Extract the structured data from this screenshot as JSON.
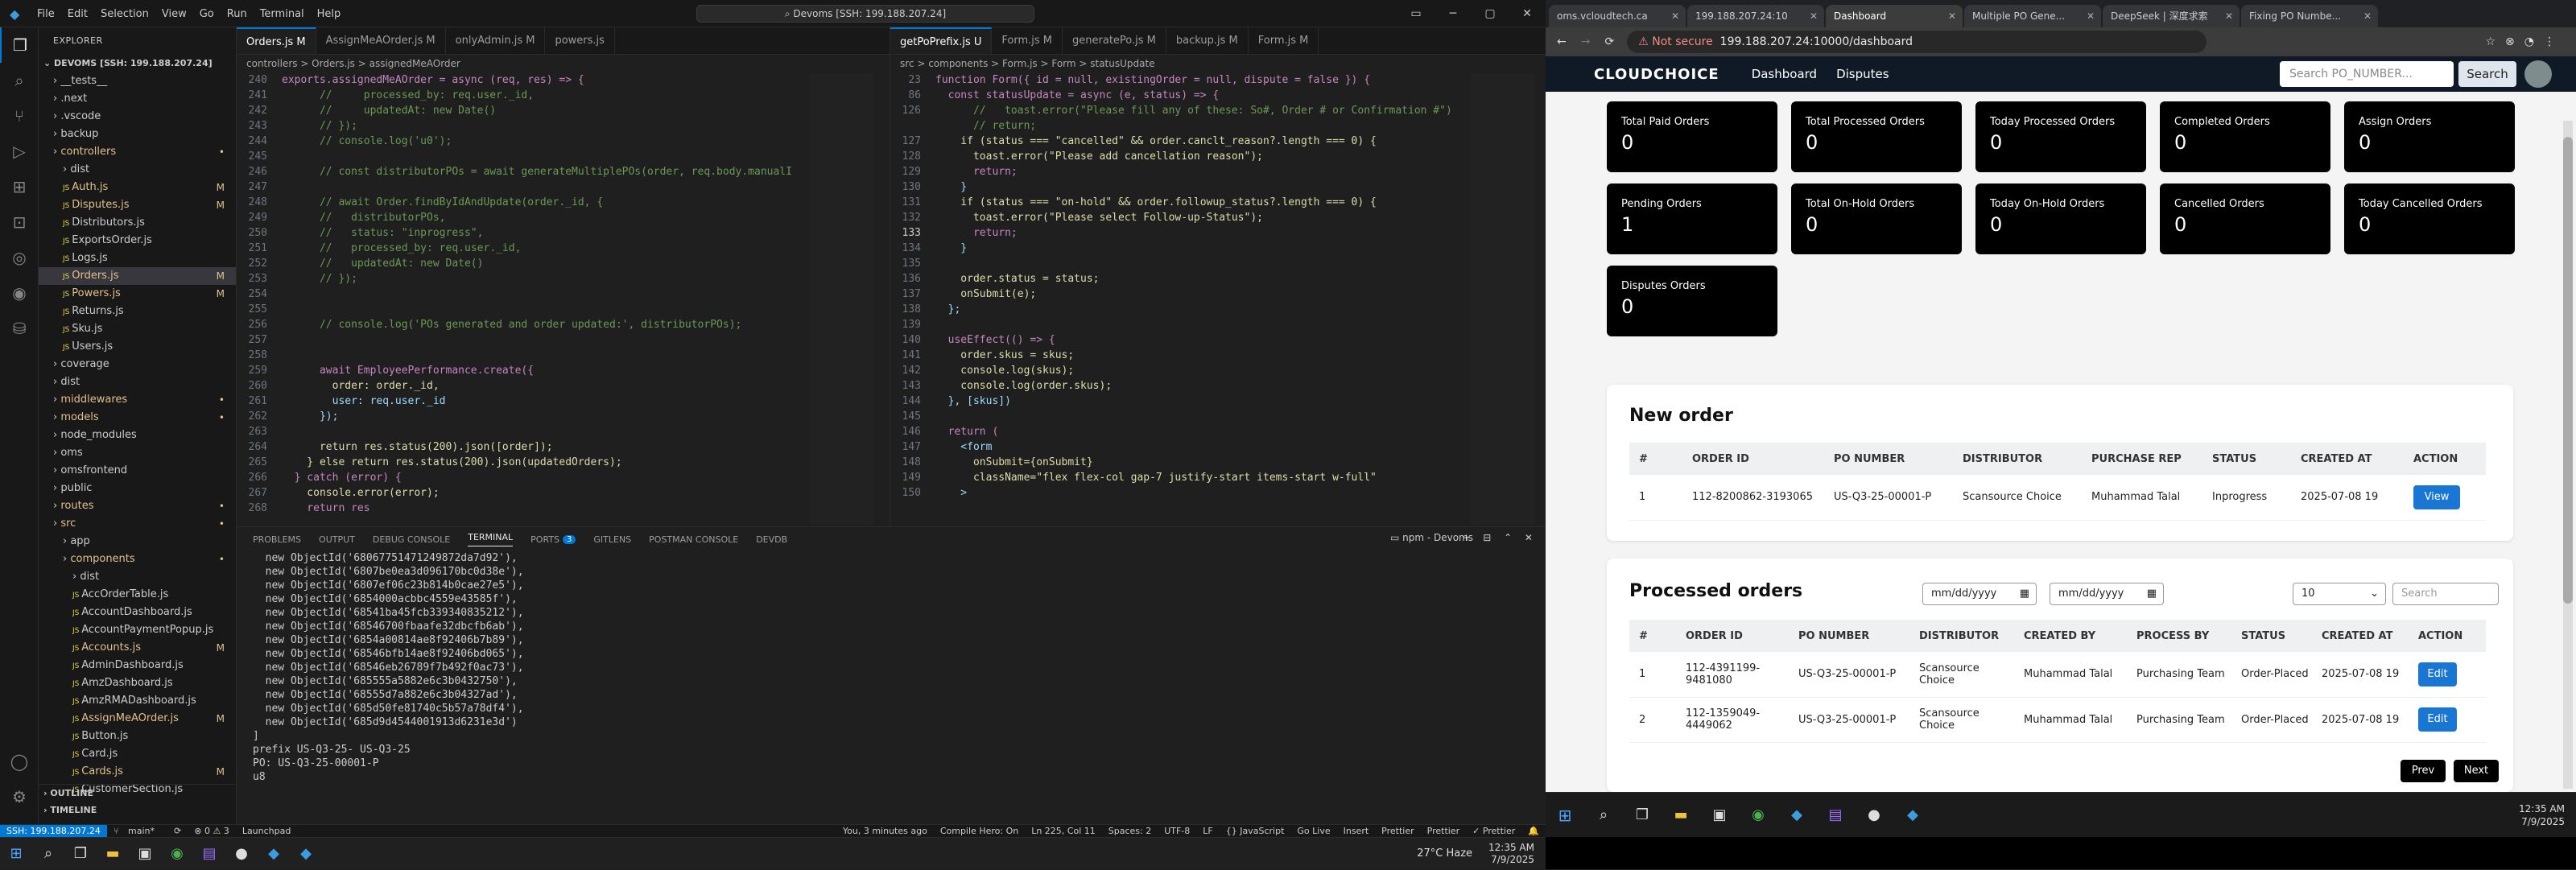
{
  "vscode": {
    "menu": [
      "File",
      "Edit",
      "Selection",
      "View",
      "Go",
      "Run",
      "Terminal",
      "Help"
    ],
    "command_center": "Devoms [SSH: 199.188.207.24]",
    "explorer_title": "EXPLORER",
    "workspace": "DEVOMS [SSH: 199.188.207.24]",
    "tree": [
      {
        "label": "__tests__",
        "indent": 1,
        "status": ""
      },
      {
        "label": ".next",
        "indent": 1,
        "status": ""
      },
      {
        "label": ".vscode",
        "indent": 1,
        "status": ""
      },
      {
        "label": "backup",
        "indent": 1,
        "status": ""
      },
      {
        "label": "controllers",
        "indent": 1,
        "status": "•"
      },
      {
        "label": "dist",
        "indent": 2,
        "status": ""
      },
      {
        "label": "Auth.js",
        "indent": 2,
        "status": "M"
      },
      {
        "label": "Disputes.js",
        "indent": 2,
        "status": "M"
      },
      {
        "label": "Distributors.js",
        "indent": 2,
        "status": ""
      },
      {
        "label": "ExportsOrder.js",
        "indent": 2,
        "status": ""
      },
      {
        "label": "Logs.js",
        "indent": 2,
        "status": ""
      },
      {
        "label": "Orders.js",
        "indent": 2,
        "status": "M",
        "selected": true
      },
      {
        "label": "Powers.js",
        "indent": 2,
        "status": "M"
      },
      {
        "label": "Returns.js",
        "indent": 2,
        "status": ""
      },
      {
        "label": "Sku.js",
        "indent": 2,
        "status": ""
      },
      {
        "label": "Users.js",
        "indent": 2,
        "status": ""
      },
      {
        "label": "coverage",
        "indent": 1,
        "status": ""
      },
      {
        "label": "dist",
        "indent": 1,
        "status": ""
      },
      {
        "label": "middlewares",
        "indent": 1,
        "status": "•"
      },
      {
        "label": "models",
        "indent": 1,
        "status": "•"
      },
      {
        "label": "node_modules",
        "indent": 1,
        "status": ""
      },
      {
        "label": "oms",
        "indent": 1,
        "status": ""
      },
      {
        "label": "omsfrontend",
        "indent": 1,
        "status": ""
      },
      {
        "label": "public",
        "indent": 1,
        "status": ""
      },
      {
        "label": "routes",
        "indent": 1,
        "status": "•"
      },
      {
        "label": "src",
        "indent": 1,
        "status": "•"
      },
      {
        "label": "app",
        "indent": 2,
        "status": ""
      },
      {
        "label": "components",
        "indent": 2,
        "status": "•"
      },
      {
        "label": "dist",
        "indent": 3,
        "status": ""
      },
      {
        "label": "AccOrderTable.js",
        "indent": 3,
        "status": ""
      },
      {
        "label": "AccountDashboard.js",
        "indent": 3,
        "status": ""
      },
      {
        "label": "AccountPaymentPopup.js",
        "indent": 3,
        "status": ""
      },
      {
        "label": "Accounts.js",
        "indent": 3,
        "status": "M"
      },
      {
        "label": "AdminDashboard.js",
        "indent": 3,
        "status": ""
      },
      {
        "label": "AmzDashboard.js",
        "indent": 3,
        "status": ""
      },
      {
        "label": "AmzRMADashboard.js",
        "indent": 3,
        "status": ""
      },
      {
        "label": "AssignMeAOrder.js",
        "indent": 3,
        "status": "M"
      },
      {
        "label": "Button.js",
        "indent": 3,
        "status": ""
      },
      {
        "label": "Card.js",
        "indent": 3,
        "status": ""
      },
      {
        "label": "Cards.js",
        "indent": 3,
        "status": "M"
      },
      {
        "label": "CustomerSection.js",
        "indent": 3,
        "status": ""
      }
    ],
    "outline": "OUTLINE",
    "timeline": "TIMELINE",
    "left_tabs": [
      "Orders.js M",
      "AssignMeAOrder.js M",
      "onlyAdmin.js M",
      "powers.js"
    ],
    "left_breadcrumb": "controllers > Orders.js > assignedMeAOrder",
    "left_code": [
      {
        "n": "240",
        "t": "exports.assignedMeAOrder = async (req, res) => {"
      },
      {
        "n": "241",
        "t": "      //     processed_by: req.user._id,"
      },
      {
        "n": "242",
        "t": "      //     updatedAt: new Date()"
      },
      {
        "n": "243",
        "t": "      // });"
      },
      {
        "n": "244",
        "t": "      // console.log('u0');"
      },
      {
        "n": "245",
        "t": ""
      },
      {
        "n": "246",
        "t": "      // const distributorPOs = await generateMultiplePOs(order, req.body.manualI"
      },
      {
        "n": "247",
        "t": ""
      },
      {
        "n": "248",
        "t": "      // await Order.findByIdAndUpdate(order._id, {"
      },
      {
        "n": "249",
        "t": "      //   distributorPOs,"
      },
      {
        "n": "250",
        "t": "      //   status: \"inprogress\","
      },
      {
        "n": "251",
        "t": "      //   processed_by: req.user._id,"
      },
      {
        "n": "252",
        "t": "      //   updatedAt: new Date()"
      },
      {
        "n": "253",
        "t": "      // });"
      },
      {
        "n": "254",
        "t": ""
      },
      {
        "n": "255",
        "t": ""
      },
      {
        "n": "256",
        "t": "      // console.log('POs generated and order updated:', distributorPOs);"
      },
      {
        "n": "257",
        "t": ""
      },
      {
        "n": "258",
        "t": ""
      },
      {
        "n": "259",
        "t": "      await EmployeePerformance.create({"
      },
      {
        "n": "260",
        "t": "        order: order._id,"
      },
      {
        "n": "261",
        "t": "        user: req.user._id"
      },
      {
        "n": "262",
        "t": "      });"
      },
      {
        "n": "263",
        "t": ""
      },
      {
        "n": "264",
        "t": "      return res.status(200).json([order]);"
      },
      {
        "n": "265",
        "t": "    } else return res.status(200).json(updatedOrders);"
      },
      {
        "n": "266",
        "t": "  } catch (error) {"
      },
      {
        "n": "267",
        "t": "    console.error(error);"
      },
      {
        "n": "268",
        "t": "    return res"
      }
    ],
    "right_tabs": [
      "getPoPrefix.js U",
      "Form.js M",
      "generatePo.js M",
      "backup.js M",
      "Form.js M"
    ],
    "right_breadcrumb": "src > components > Form.js > Form > statusUpdate",
    "right_code": [
      {
        "n": "23",
        "t": "function Form({ id = null, existingOrder = null, dispute = false }) {"
      },
      {
        "n": "86",
        "t": "  const statusUpdate = async (e, status) => {"
      },
      {
        "n": "126",
        "t": "      //   toast.error(\"Please fill any of these: So#, Order # or Confirmation #\")"
      },
      {
        "n": "",
        "t": "      // return;"
      },
      {
        "n": "127",
        "t": "    if (status === \"cancelled\" && order.canclt_reason?.length === 0) {"
      },
      {
        "n": "128",
        "t": "      toast.error(\"Please add cancellation reason\");"
      },
      {
        "n": "129",
        "t": "      return;"
      },
      {
        "n": "130",
        "t": "    }"
      },
      {
        "n": "131",
        "t": "    if (status === \"on-hold\" && order.followup_status?.length === 0) {"
      },
      {
        "n": "132",
        "t": "      toast.error(\"Please select Follow-up-Status\");"
      },
      {
        "n": "133",
        "t": "      return;"
      },
      {
        "n": "134",
        "t": "    }"
      },
      {
        "n": "135",
        "t": ""
      },
      {
        "n": "136",
        "t": "    order.status = status;"
      },
      {
        "n": "137",
        "t": "    onSubmit(e);"
      },
      {
        "n": "138",
        "t": "  };"
      },
      {
        "n": "139",
        "t": ""
      },
      {
        "n": "140",
        "t": "  useEffect(() => {"
      },
      {
        "n": "141",
        "t": "    order.skus = skus;"
      },
      {
        "n": "142",
        "t": "    console.log(skus);"
      },
      {
        "n": "143",
        "t": "    console.log(order.skus);"
      },
      {
        "n": "144",
        "t": "  }, [skus])"
      },
      {
        "n": "145",
        "t": ""
      },
      {
        "n": "146",
        "t": "  return ("
      },
      {
        "n": "147",
        "t": "    <form"
      },
      {
        "n": "148",
        "t": "      onSubmit={onSubmit}"
      },
      {
        "n": "149",
        "t": "      className=\"flex flex-col gap-7 justify-start items-start w-full\""
      },
      {
        "n": "150",
        "t": "    >"
      }
    ],
    "panel_tabs": [
      "PROBLEMS",
      "OUTPUT",
      "DEBUG CONSOLE",
      "TERMINAL",
      "PORTS",
      "GITLENS",
      "POSTMAN CONSOLE",
      "DEVDB"
    ],
    "ports_badge": "3",
    "terminal_name": "npm - Devoms",
    "terminal_lines": [
      "  new ObjectId('68067751471249872da7d92'),",
      "  new ObjectId('6807be0ea3d096170bc0d38e'),",
      "  new ObjectId('6807ef06c23b814b0cae27e5'),",
      "  new ObjectId('6854000acbbc4559e43585f'),",
      "  new ObjectId('68541ba45fcb339340835212'),",
      "  new ObjectId('68546700fbaafe32dbcfb6ab'),",
      "  new ObjectId('6854a00814ae8f92406b7b89'),",
      "  new ObjectId('68546bfb14ae8f92406bd065'),",
      "  new ObjectId('68546eb26789f7b492f0ac73'),",
      "  new ObjectId('685555a5882e6c3b0432750'),",
      "  new ObjectId('68555d7a882e6c3b04327ad'),",
      "  new ObjectId('685d50fe81740c5b57a78df4'),",
      "  new ObjectId('685d9d4544001913d6231e3d')",
      "]",
      "prefix US-Q3-25- US-Q3-25",
      "PO: US-Q3-25-00001-P",
      "u8"
    ],
    "status": {
      "remote": "SSH: 199.188.207.24",
      "branch": "main*",
      "sync": "⟳",
      "errors": "⊗ 0 ⚠ 3",
      "launchpad": "Launchpad",
      "blame": "You, 3 minutes ago",
      "compile": "Compile Hero: On",
      "pos": "Ln 225, Col 11",
      "spaces": "Spaces: 2",
      "enc": "UTF-8",
      "eol": "LF",
      "lang": "{} JavaScript",
      "golive": "Go Live",
      "insert": "Insert",
      "prettier": "Prettier",
      "prettier2": "Prettier",
      "prettier3": "✓ Prettier"
    }
  },
  "taskbar_left": {
    "weather": "27°C Haze",
    "time": "12:35 AM",
    "date": "7/9/2025"
  },
  "browser": {
    "tabs": [
      "oms.vcloudtech.ca",
      "199.188.207.24:10",
      "Dashboard",
      "Multiple PO Gene...",
      "DeepSeek | 深度求索",
      "Fixing PO Numbe..."
    ],
    "not_secure": "Not secure",
    "url": "199.188.207.24:10000/dashboard",
    "brand": "CLOUDCHOICE",
    "nav": [
      "Dashboard",
      "Disputes"
    ],
    "search_placeholder": "Search PO_NUMBER...",
    "search_btn": "Search",
    "top_fragment": "Dashboard",
    "cards": [
      {
        "t": "Total Paid Orders",
        "v": "0"
      },
      {
        "t": "Total Processed Orders",
        "v": "0"
      },
      {
        "t": "Today Processed Orders",
        "v": "0"
      },
      {
        "t": "Completed Orders",
        "v": "0"
      },
      {
        "t": "Assign Orders",
        "v": "0"
      },
      {
        "t": "Pending Orders",
        "v": "1"
      },
      {
        "t": "Total On-Hold Orders",
        "v": "0"
      },
      {
        "t": "Today On-Hold Orders",
        "v": "0"
      },
      {
        "t": "Cancelled Orders",
        "v": "0"
      },
      {
        "t": "Today Cancelled Orders",
        "v": "0"
      },
      {
        "t": "Disputes Orders",
        "v": "0"
      }
    ],
    "new_order": {
      "title": "New order",
      "headers": [
        "#",
        "ORDER ID",
        "PO NUMBER",
        "DISTRIBUTOR",
        "PURCHASE REP",
        "STATUS",
        "CREATED AT",
        "ACTION"
      ],
      "rows": [
        [
          "1",
          "112-8200862-3193065",
          "US-Q3-25-00001-P",
          "Scansource Choice",
          "Muhammad Talal",
          "Inprogress",
          "2025-07-08 19",
          "View"
        ]
      ]
    },
    "processed": {
      "title": "Processed orders",
      "date1": "mm/dd/yyyy",
      "date2": "mm/dd/yyyy",
      "per_page": "10",
      "search_placeholder": "Search",
      "headers": [
        "#",
        "ORDER ID",
        "PO NUMBER",
        "DISTRIBUTOR",
        "CREATED BY",
        "PROCESS BY",
        "STATUS",
        "CREATED AT",
        "ACTION"
      ],
      "rows": [
        [
          "1",
          "112-4391199-9481080",
          "US-Q3-25-00001-P",
          "Scansource Choice",
          "Muhammad Talal",
          "Purchasing Team",
          "Order-Placed",
          "2025-07-08 19",
          "Edit"
        ],
        [
          "2",
          "112-1359049-4449062",
          "US-Q3-25-00001-P",
          "Scansource Choice",
          "Muhammad Talal",
          "Purchasing Team",
          "Order-Placed",
          "2025-07-08 19",
          "Edit"
        ]
      ],
      "prev": "Prev",
      "next": "Next"
    }
  },
  "taskbar_right": {
    "time": "12:35 AM",
    "date": "7/9/2025"
  }
}
